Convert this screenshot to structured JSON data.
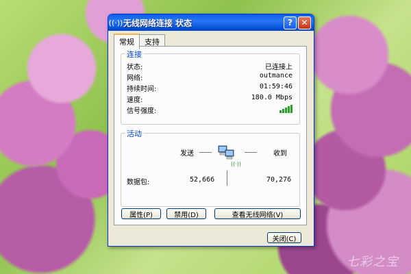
{
  "window": {
    "title": "无线网络连接 状态"
  },
  "tabs": [
    {
      "label": "常规"
    },
    {
      "label": "支持"
    }
  ],
  "connection": {
    "group_title": "连接",
    "status_label": "状态:",
    "status_value": "已连接上",
    "network_label": "网络:",
    "network_value": "outmance",
    "duration_label": "持续时间:",
    "duration_value": "01:59:46",
    "speed_label": "速度:",
    "speed_value": "180.0 Mbps",
    "signal_label": "信号强度:",
    "signal_bars_filled": 5,
    "signal_bars_total": 5
  },
  "activity": {
    "group_title": "活动",
    "sent_label": "发送",
    "received_label": "收到",
    "packets_label": "数据包:",
    "packets_sent": "52,666",
    "packets_received": "70,276"
  },
  "buttons": {
    "properties": "属性(P)",
    "disable": "禁用(D)",
    "view_networks": "查看无线网络(V)",
    "close": "关闭(C)"
  },
  "watermark": "七彩之宝"
}
